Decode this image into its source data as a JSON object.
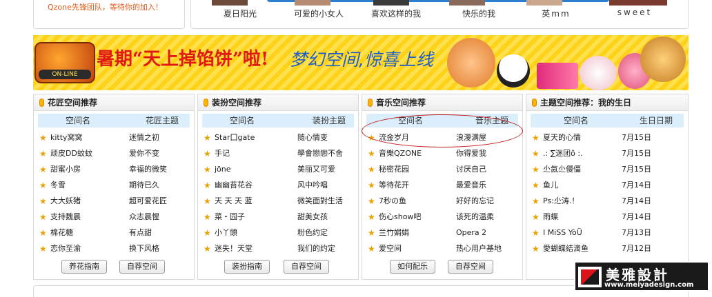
{
  "top": {
    "tagline": "Qzone先锋团队，等待你的加入！",
    "thumbs": [
      "夏日阳光",
      "可爱的小女人",
      "喜欢这样的我",
      "快乐的我",
      "英mm",
      "sweet"
    ]
  },
  "banner": {
    "logo_text": "ON-LINE",
    "headline": "暑期“天上掉馅饼”啦!",
    "subline": "梦幻空间,惊喜上线"
  },
  "panels": [
    {
      "title": "花匠空间推荐",
      "col1": "空间名",
      "col2": "花匠主题",
      "rows": [
        {
          "name": "kitty窝窝",
          "theme": "迷情之初"
        },
        {
          "name": "顽皮DD蚊蚊",
          "theme": "爱你不变"
        },
        {
          "name": "甜蜜小房",
          "theme": "幸福的微笑"
        },
        {
          "name": "冬雪",
          "theme": "期待已久"
        },
        {
          "name": "大大妖猪",
          "theme": "超可爱花匠"
        },
        {
          "name": "支持魏晨",
          "theme": "众志晨惺"
        },
        {
          "name": "棉花糖",
          "theme": "有点甜"
        },
        {
          "name": "恋你至渝",
          "theme": "换下风格"
        }
      ],
      "buttons": [
        "养花指南",
        "自荐空间"
      ]
    },
    {
      "title": "装扮空间推荐",
      "col1": "空间名",
      "col2": "装扮主题",
      "rows": [
        {
          "name": "Star囗gate",
          "theme": "随心情变"
        },
        {
          "name": "手记",
          "theme": "學會戀戀不舍"
        },
        {
          "name": "jōne",
          "theme": "美丽又可爱"
        },
        {
          "name": "幽幽苔花谷",
          "theme": "风中吟唱"
        },
        {
          "name": "天 天 天 蓝",
          "theme": "微笑面對生活"
        },
        {
          "name": "菜・园子",
          "theme": "甜美女孩"
        },
        {
          "name": "小丫頭",
          "theme": "粉色约定"
        },
        {
          "name": "迷失！天堂",
          "theme": "我们的约定"
        }
      ],
      "buttons": [
        "装扮指南",
        "自荐空间"
      ]
    },
    {
      "title": "音乐空间推荐",
      "col1": "空间名",
      "col2": "音乐主题",
      "rows": [
        {
          "name": "流金岁月",
          "theme": "浪漫满屋"
        },
        {
          "name": "音樂QZONE",
          "theme": "你得爱我"
        },
        {
          "name": "秘密花园",
          "theme": "讨厌自己"
        },
        {
          "name": "等待花开",
          "theme": "最爱音乐"
        },
        {
          "name": "7秒の鱼",
          "theme": "好好的忘记"
        },
        {
          "name": "伤心show吧",
          "theme": "该死的温柔"
        },
        {
          "name": "兰竹娟娟",
          "theme": "Opera 2"
        },
        {
          "name": "爱空间",
          "theme": "热心用户基地"
        }
      ],
      "buttons": [
        "如何配乐",
        "自荐空间"
      ]
    },
    {
      "title": "主题空间推荐：我的生日",
      "col1": "空间名",
      "col2": "生日日期",
      "rows": [
        {
          "name": "夏天的心情",
          "theme": "7月15日"
        },
        {
          "name": ".: ∑迷团ô :.",
          "theme": "7月15日"
        },
        {
          "name": "尐氤尐僈僵",
          "theme": "7月15日"
        },
        {
          "name": "鱼儿",
          "theme": "7月14日"
        },
        {
          "name": "Ps:尐涛.！",
          "theme": "7月14日"
        },
        {
          "name": "雨蝶",
          "theme": "7月14日"
        },
        {
          "name": "I MiSS YòÜ",
          "theme": "7月13日"
        },
        {
          "name": "愛蝴蝶結滴鱼",
          "theme": "7月12日"
        }
      ],
      "buttons": []
    }
  ],
  "watermark": {
    "title": "美雅設計",
    "url": "www.meiyadesign.com"
  },
  "colors": {
    "banner_yellow": "#ffd21a",
    "headline_red": "#e01a12",
    "subline_blue": "#1f5fc8",
    "header_blue": "#dbeefb",
    "annotation_red": "#c21a1a"
  }
}
